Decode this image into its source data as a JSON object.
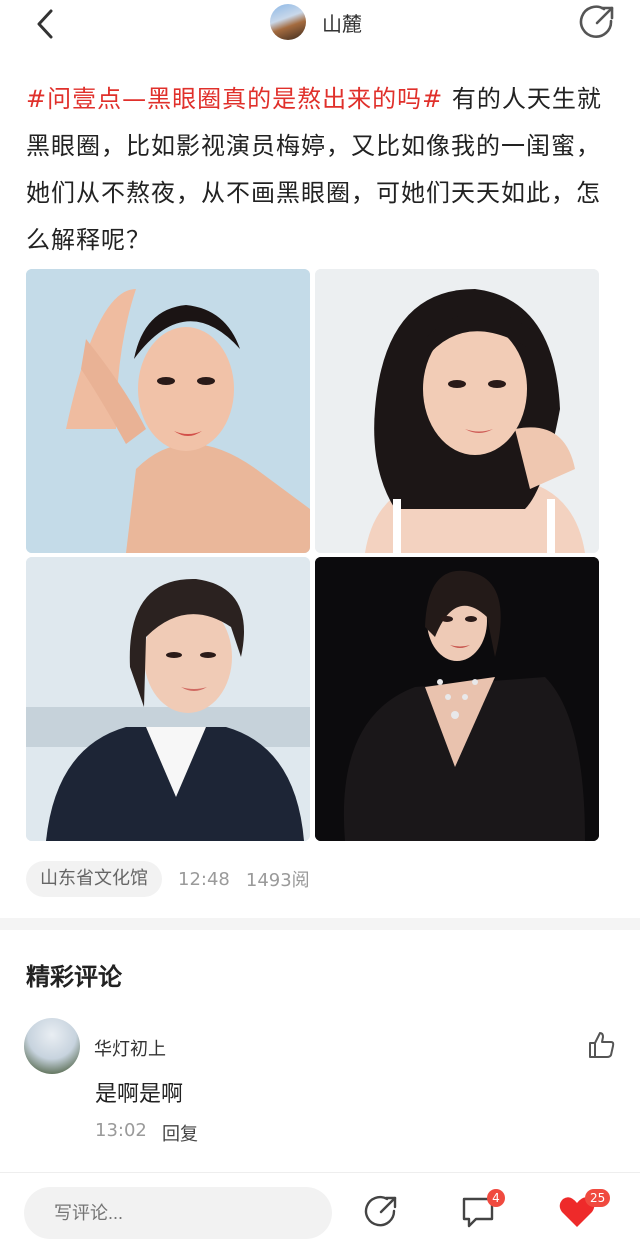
{
  "header": {
    "author_name": "山麓"
  },
  "post": {
    "hashtag": "#问壹点—黑眼圈真的是熬出来的吗#",
    "body": " 有的人天生就黑眼圈，比如影视演员梅婷，又比如像我的一闺蜜，她们从不熬夜，从不画黑眼圈，可她们天天如此，怎么解释呢？"
  },
  "meta": {
    "source": "山东省文化馆",
    "time": "12:48",
    "views": "1493阅"
  },
  "comments_section": {
    "title": "精彩评论",
    "items": [
      {
        "user": "华灯初上",
        "text": "是啊是啊",
        "time": "13:02",
        "reply_label": "回复"
      }
    ]
  },
  "bottom_bar": {
    "input_placeholder": "写评论...",
    "comment_count": "4",
    "like_count": "25"
  },
  "colors": {
    "hashtag": "#e0302b",
    "badge": "#f04a3f",
    "heart": "#ee2a2a"
  },
  "icons": [
    "back-icon",
    "share-icon",
    "thumbs-up-icon",
    "comment-icon",
    "heart-icon"
  ]
}
